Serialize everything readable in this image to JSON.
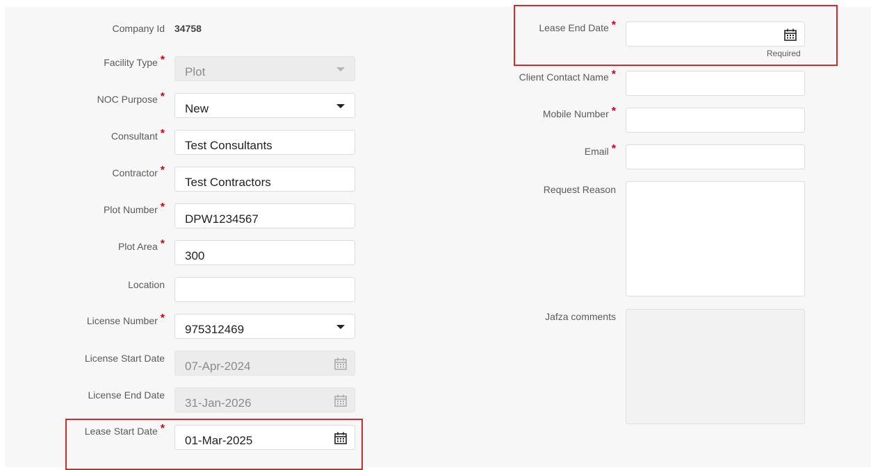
{
  "form": {
    "company_id": {
      "label": "Company Id",
      "value": "34758"
    },
    "facility_type": {
      "label": "Facility Type",
      "value": "Plot",
      "required": "*"
    },
    "noc_purpose": {
      "label": "NOC Purpose",
      "value": "New",
      "required": "*"
    },
    "consultant": {
      "label": "Consultant",
      "value": "Test Consultants",
      "required": "*"
    },
    "contractor": {
      "label": "Contractor",
      "value": "Test Contractors",
      "required": "*"
    },
    "plot_number": {
      "label": "Plot Number",
      "value": "DPW1234567",
      "required": "*"
    },
    "plot_area": {
      "label": "Plot Area",
      "value": "300",
      "required": "*"
    },
    "location": {
      "label": "Location",
      "value": ""
    },
    "license_number": {
      "label": "License Number",
      "value": "975312469",
      "required": "*"
    },
    "license_start_date": {
      "label": "License Start Date",
      "value": "07-Apr-2024"
    },
    "license_end_date": {
      "label": "License End Date",
      "value": "31-Jan-2026"
    },
    "lease_start_date": {
      "label": "Lease Start Date",
      "value": "01-Mar-2025",
      "required": "*"
    },
    "lease_end_date": {
      "label": "Lease End Date",
      "value": "",
      "required": "*",
      "hint": "Required"
    },
    "client_contact_name": {
      "label": "Client Contact Name",
      "value": "",
      "required": "*"
    },
    "mobile_number": {
      "label": "Mobile Number",
      "value": "",
      "required": "*"
    },
    "email": {
      "label": "Email",
      "value": "",
      "required": "*"
    },
    "request_reason": {
      "label": "Request Reason",
      "value": ""
    },
    "jafza_comments": {
      "label": "Jafza comments",
      "value": ""
    }
  },
  "icons": {
    "calendar": "calendar-icon",
    "dropdown": "chevron-down-icon"
  },
  "colors": {
    "required": "#d0021b",
    "highlight": "#d62a2a"
  }
}
